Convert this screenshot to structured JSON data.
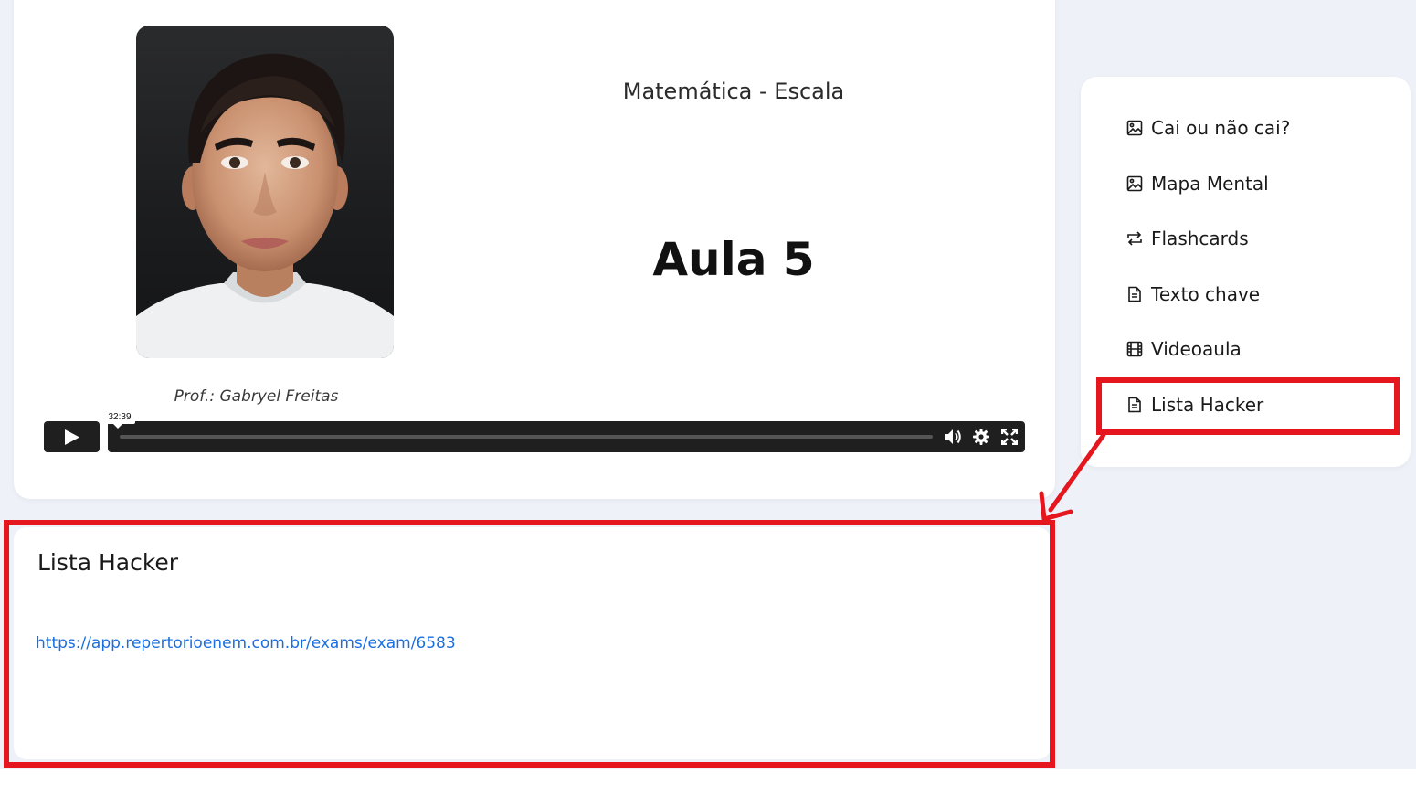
{
  "slide": {
    "subtitle": "Matemática - Escala",
    "title": "Aula 5",
    "professor": "Prof.: Gabryel Freitas"
  },
  "player": {
    "time_tooltip": "32:39",
    "progress": 0
  },
  "sidebar": {
    "items": [
      {
        "label": "Cai ou não cai?",
        "icon": "image-icon"
      },
      {
        "label": "Mapa Mental",
        "icon": "image-icon"
      },
      {
        "label": "Flashcards",
        "icon": "repeat-icon"
      },
      {
        "label": "Texto chave",
        "icon": "document-icon"
      },
      {
        "label": "Videoaula",
        "icon": "film-icon"
      },
      {
        "label": "Lista Hacker",
        "icon": "document-icon"
      }
    ]
  },
  "content": {
    "title": "Lista Hacker",
    "link": "https://app.repertorioenem.com.br/exams/exam/6583"
  },
  "colors": {
    "highlight": "#e5161d",
    "link": "#1a6ee0",
    "player_bg": "#1f1f1f",
    "page_bg": "#eef1f8"
  }
}
